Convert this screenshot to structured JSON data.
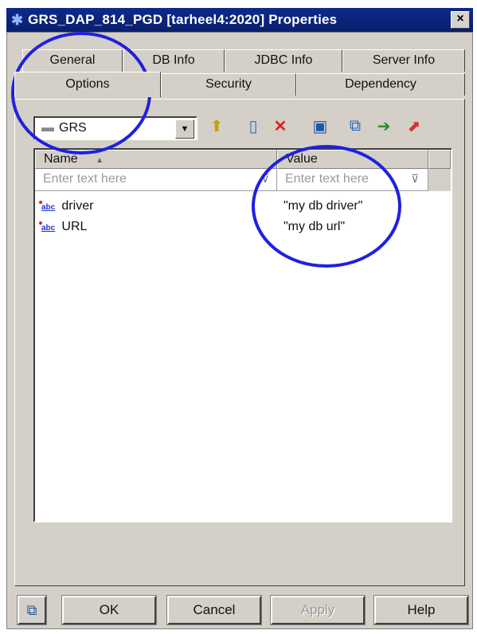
{
  "window": {
    "title": "GRS_DAP_814_PGD [tarheel4:2020] Properties",
    "close_glyph": "×"
  },
  "tabs": {
    "row1": [
      "General",
      "DB Info",
      "JDBC Info",
      "Server Info"
    ],
    "row2": [
      "Options",
      "Security",
      "Dependency"
    ],
    "active": "Options"
  },
  "toolbar": {
    "combo_value": "GRS",
    "combo_arrow": "▼"
  },
  "grid": {
    "columns": [
      "Name",
      "Value"
    ],
    "filter_placeholders": [
      "Enter text here",
      "Enter text here"
    ],
    "rows": [
      {
        "name": "driver",
        "value": "\"my db driver\""
      },
      {
        "name": "URL",
        "value": "\"my db url\""
      }
    ],
    "type_icon_text": "abc"
  },
  "buttons": {
    "ok": "OK",
    "cancel": "Cancel",
    "apply": "Apply",
    "help": "Help"
  },
  "colors": {
    "title_bar": "#0d2a8a",
    "annotation_circle": "#2020e0",
    "delete_red": "#e02020"
  }
}
